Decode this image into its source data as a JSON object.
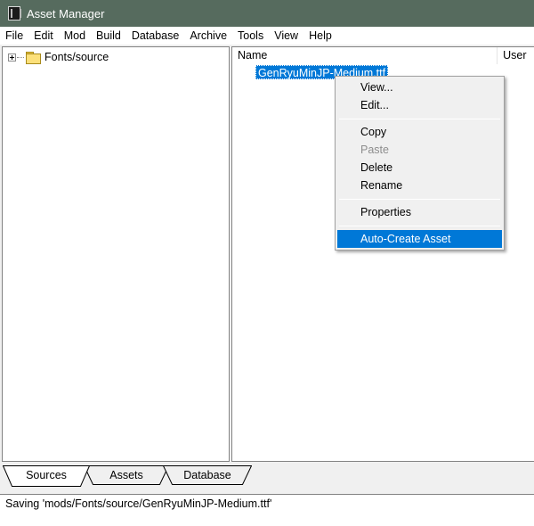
{
  "window": {
    "title": "Asset Manager",
    "icon": "archive-icon"
  },
  "menubar": {
    "items": [
      "File",
      "Edit",
      "Mod",
      "Build",
      "Database",
      "Archive",
      "Tools",
      "View",
      "Help"
    ]
  },
  "tree": {
    "root_label": "Fonts/source",
    "icon": "folder-icon"
  },
  "list": {
    "columns": [
      "Name",
      "User"
    ],
    "rows": [
      {
        "name": "GenRyuMinJP-Medium.ttf",
        "selected": true
      }
    ]
  },
  "context_menu": {
    "items": {
      "view": "View...",
      "edit": "Edit...",
      "copy": "Copy",
      "paste": "Paste",
      "delete": "Delete",
      "rename": "Rename",
      "properties": "Properties",
      "auto_create": "Auto-Create Asset"
    },
    "highlighted": "Auto-Create Asset",
    "disabled": [
      "Paste"
    ]
  },
  "tabs": [
    {
      "label": "Sources",
      "active": true
    },
    {
      "label": "Assets",
      "active": false
    },
    {
      "label": "Database",
      "active": false
    }
  ],
  "status": {
    "text": "Saving 'mods/Fonts/source/GenRyuMinJP-Medium.ttf'"
  },
  "colors": {
    "titlebar": "#566b5e",
    "selection": "#0078d7",
    "background": "#f0f0f0"
  }
}
